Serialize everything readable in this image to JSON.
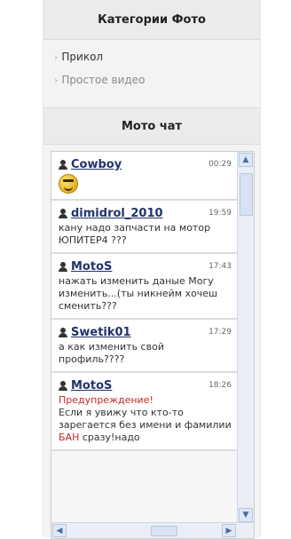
{
  "categories_block": {
    "title": "Категории Фото",
    "items": [
      {
        "label": "Прикол",
        "muted": false
      },
      {
        "label": "Простое видео",
        "muted": true
      }
    ]
  },
  "chat_block": {
    "title": "Мото чат",
    "messages": [
      {
        "user": "Cowboy",
        "time": "00:29",
        "text": "",
        "emoji": "smile-icon"
      },
      {
        "user": "dimidrol_2010",
        "time": "19:59",
        "text": "кану надо запчасти на мотор ЮПИТЕР4 ???"
      },
      {
        "user": "MotoS",
        "time": "17:43",
        "text": "нажать изменить даные Могу изменить...(ты никнейм хочеш сменить???"
      },
      {
        "user": "Swetik01",
        "time": "17:29",
        "text": "а как изменить свой профиль????"
      },
      {
        "user": "MotoS",
        "time": "18:26",
        "warning": "Предупреждение!",
        "text_before_ban": "Если я увижу что кто-то зарегается без имени и фамилии",
        "ban": "БАН",
        "text_after_ban": "сразу!надо"
      }
    ]
  },
  "colors": {
    "username": "#20336b",
    "warning": "#c62828",
    "panel_bg": "#f3f3f3",
    "header_bg": "#ebebeb",
    "scrollbar": "#e9eef7"
  },
  "icons": {
    "user": "user-icon",
    "scroll_up": "▲",
    "scroll_down": "▼",
    "scroll_left": "◀",
    "scroll_right": "▶"
  }
}
